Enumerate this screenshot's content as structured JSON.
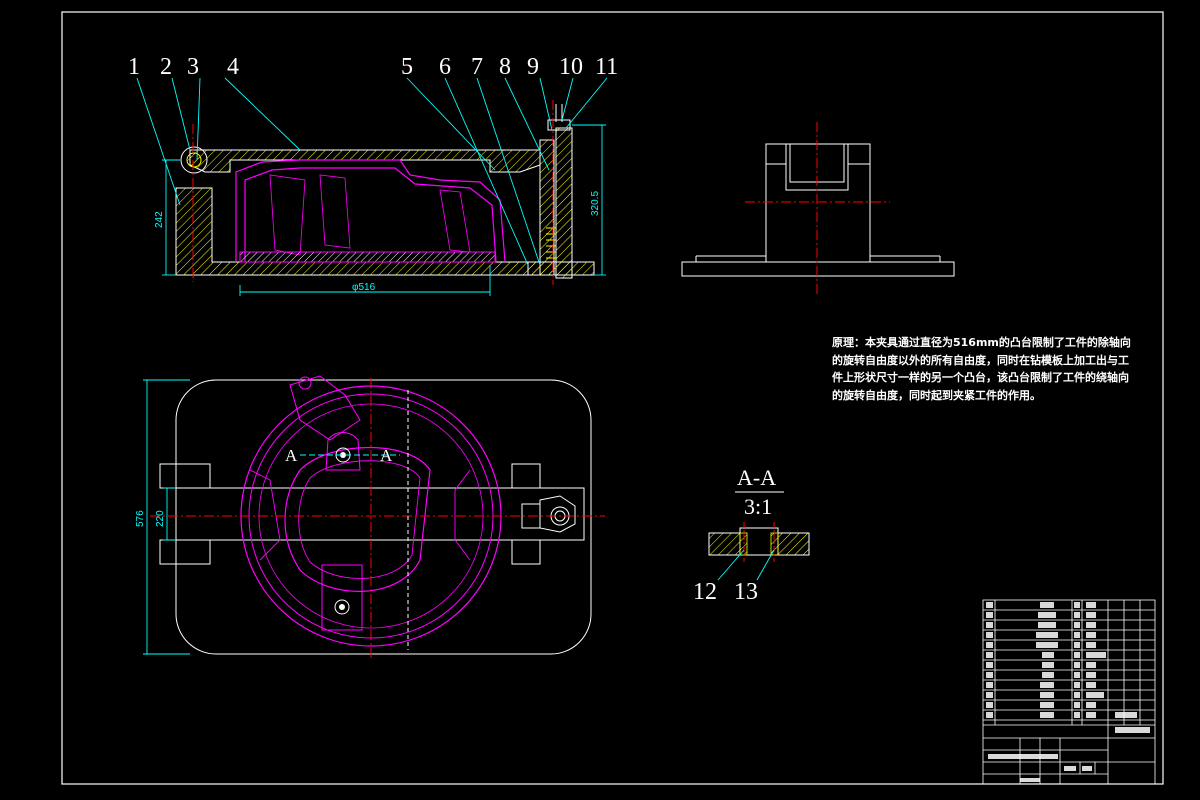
{
  "drawing": {
    "part_labels": [
      "1",
      "2",
      "3",
      "4",
      "5",
      "6",
      "7",
      "8",
      "9",
      "10",
      "11",
      "12",
      "13"
    ],
    "dimensions": {
      "height_left": "242",
      "height_right": "320.5",
      "diameter": "φ516",
      "width_outer": "576",
      "width_inner": "220"
    },
    "section_marker": "A",
    "section_title": "A-A",
    "section_scale": "3:1",
    "principle_note": "原理：本夹具通过直径为516mm的凸台限制了工件的除轴向的旋转自由度以外的所有自由度，同时在钻模板上加工出与工件上形状尺寸一样的另一个凸台，该凸台限制了工件的绕轴向的旋转自由度，同时起到夹紧工件的作用。"
  },
  "colors": {
    "background": "#000000",
    "outline": "#ffffff",
    "hatch": "#ffff00",
    "part": "#ff00ff",
    "centerline": "#ff0000",
    "dimension": "#00ffff"
  }
}
